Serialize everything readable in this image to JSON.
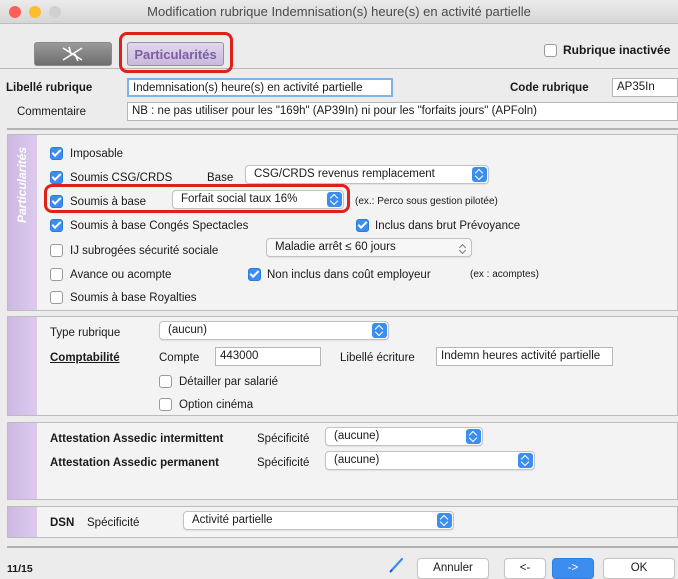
{
  "window": {
    "title": "Modification rubrique Indemnisation(s) heure(s) en activité partielle"
  },
  "tabs": {
    "particularites": "Particularités"
  },
  "rubrique_inactive": {
    "label": "Rubrique inactivée",
    "checked": false
  },
  "header": {
    "libelle_label": "Libellé rubrique",
    "libelle_value": "Indemnisation(s) heure(s) en activité partielle",
    "code_label": "Code rubrique",
    "code_value": "AP35In",
    "commentaire_label": "Commentaire",
    "commentaire_value": "NB : ne pas utiliser pour les \"169h\" (AP39In) ni pour les \"forfaits jours\" (APFoln)"
  },
  "side_label": "Particularités",
  "particularites": {
    "imposable": {
      "label": "Imposable",
      "checked": true
    },
    "soumis_csg": {
      "label": "Soumis CSG/CRDS",
      "checked": true
    },
    "base_label": "Base",
    "base_select": "CSG/CRDS revenus remplacement",
    "soumis_base": {
      "label": "Soumis à base",
      "checked": true
    },
    "soumis_base_select": "Forfait social taux 16%",
    "soumis_base_hint": "(ex.: Perco sous gestion pilotée)",
    "soumis_conges": {
      "label": "Soumis à base Congés Spectacles",
      "checked": true
    },
    "inclus_prevoyance": {
      "label": "Inclus dans brut Prévoyance",
      "checked": true
    },
    "ij_subrogees": {
      "label": "IJ subrogées sécurité sociale",
      "checked": false
    },
    "ij_select": "Maladie arrêt ≤ 60 jours",
    "avance": {
      "label": "Avance ou acompte",
      "checked": false
    },
    "non_inclus": {
      "label": "Non inclus dans coût employeur",
      "checked": true
    },
    "non_inclus_hint": "(ex : acomptes)",
    "royalties": {
      "label": "Soumis à base Royalties",
      "checked": false
    }
  },
  "compta": {
    "type_label": "Type rubrique",
    "type_select": "(aucun)",
    "comptabilite_label": "Comptabilité",
    "compte_label": "Compte",
    "compte_value": "443000",
    "libelle_ecriture_label": "Libellé écriture",
    "libelle_ecriture_value": "Indemn heures activité partielle",
    "detailler": {
      "label": "Détailler par salarié",
      "checked": false
    },
    "cinema": {
      "label": "Option cinéma",
      "checked": false
    }
  },
  "assedic": {
    "intermittent_label": "Attestation Assedic intermittent",
    "permanent_label": "Attestation Assedic permanent",
    "specificite_label": "Spécificité",
    "intermittent_select": "(aucune)",
    "permanent_select": "(aucune)"
  },
  "dsn": {
    "label": "DSN",
    "specificite_label": "Spécificité",
    "select": "Activité partielle"
  },
  "footer": {
    "page": "11/15",
    "annuler": "Annuler",
    "prev": "<-",
    "next": "->",
    "ok": "OK"
  },
  "colors": {
    "accent": "#3b8ef0",
    "highlight": "#e0201b",
    "purple": "#7b5fa3"
  }
}
